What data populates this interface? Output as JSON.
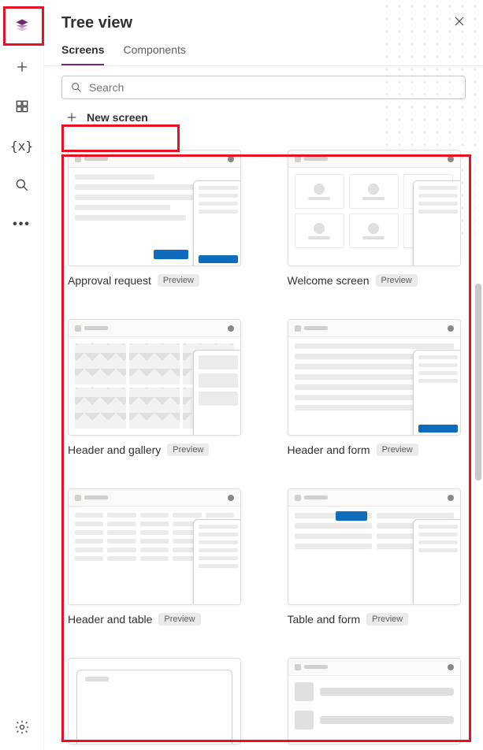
{
  "panel": {
    "title": "Tree view",
    "tabs": [
      {
        "id": "screens",
        "label": "Screens",
        "active": true
      },
      {
        "id": "components",
        "label": "Components",
        "active": false
      }
    ],
    "search_placeholder": "Search",
    "new_screen_label": "New screen"
  },
  "rail": {
    "items": [
      {
        "name": "tree-view-icon",
        "active": true
      },
      {
        "name": "insert-icon"
      },
      {
        "name": "data-icon"
      },
      {
        "name": "variables-icon"
      },
      {
        "name": "search-icon"
      },
      {
        "name": "more-icon"
      }
    ],
    "footer": {
      "name": "settings-icon"
    }
  },
  "templates": [
    {
      "id": "approval-request",
      "label": "Approval request",
      "badge": "Preview",
      "thumb": "form-overlay"
    },
    {
      "id": "welcome-screen",
      "label": "Welcome screen",
      "badge": "Preview",
      "thumb": "tiles"
    },
    {
      "id": "header-gallery",
      "label": "Header and gallery",
      "badge": "Preview",
      "thumb": "gallery"
    },
    {
      "id": "header-form",
      "label": "Header and form",
      "badge": "Preview",
      "thumb": "form-rows"
    },
    {
      "id": "header-table",
      "label": "Header and table",
      "badge": "Preview",
      "thumb": "table"
    },
    {
      "id": "table-form",
      "label": "Table and form",
      "badge": "Preview",
      "thumb": "table-form"
    },
    {
      "id": "browser",
      "label": "",
      "badge": "",
      "thumb": "browser"
    },
    {
      "id": "list",
      "label": "",
      "badge": "",
      "thumb": "list"
    }
  ]
}
